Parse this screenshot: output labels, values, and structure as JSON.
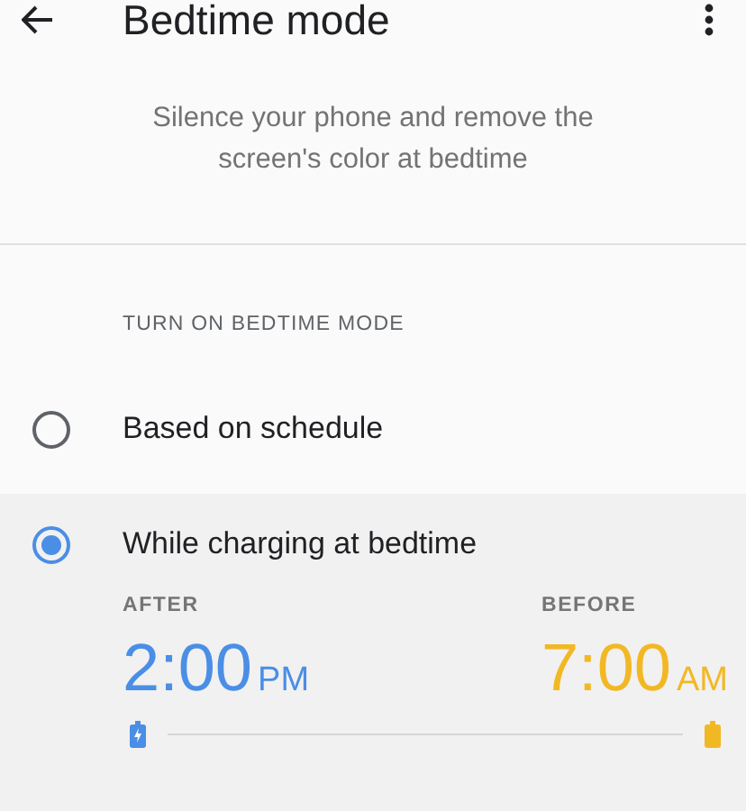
{
  "app_bar": {
    "title": "Bedtime mode"
  },
  "description": "Silence your phone and remove the screen's color at bedtime",
  "section_header": "TURN ON BEDTIME MODE",
  "options": [
    {
      "label": "Based on schedule",
      "selected": false
    },
    {
      "label": "While charging at bedtime",
      "selected": true
    }
  ],
  "times": [
    {
      "label": "AFTER",
      "time": "2:00",
      "period": "PM",
      "color": "#4a8ee6"
    },
    {
      "label": "BEFORE",
      "time": "7:00",
      "period": "AM",
      "color": "#f2b824"
    }
  ]
}
